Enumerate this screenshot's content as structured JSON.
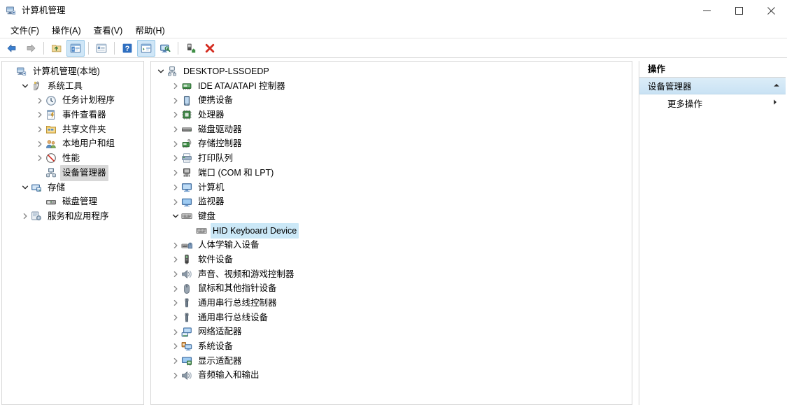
{
  "window": {
    "title": "计算机管理",
    "icon": "computer-management-icon",
    "controls": {
      "minimize": "最小化",
      "maximize": "最大化",
      "close": "关闭"
    }
  },
  "menubar": {
    "items": [
      {
        "label": "文件(F)",
        "name": "menu-file"
      },
      {
        "label": "操作(A)",
        "name": "menu-action"
      },
      {
        "label": "查看(V)",
        "name": "menu-view"
      },
      {
        "label": "帮助(H)",
        "name": "menu-help"
      }
    ]
  },
  "toolbar": {
    "buttons": [
      {
        "name": "back-button",
        "icon": "back-arrow-icon",
        "active": false
      },
      {
        "name": "forward-button",
        "icon": "forward-arrow-icon",
        "active": false
      },
      {
        "sep": true
      },
      {
        "name": "up-one-level-button",
        "icon": "folder-up-icon",
        "active": false
      },
      {
        "name": "show-hide-tree-button",
        "icon": "console-tree-icon",
        "active": true
      },
      {
        "sep": true
      },
      {
        "name": "properties-button",
        "icon": "properties-icon",
        "active": false
      },
      {
        "sep": true
      },
      {
        "name": "help-button",
        "icon": "help-question-icon",
        "active": false
      },
      {
        "name": "show-action-pane-button",
        "icon": "action-pane-icon",
        "active": true
      },
      {
        "name": "scan-hardware-button",
        "icon": "monitor-scan-icon",
        "active": false
      },
      {
        "sep": true
      },
      {
        "name": "update-driver-button",
        "icon": "update-driver-icon",
        "active": false
      },
      {
        "name": "uninstall-device-button",
        "icon": "red-x-icon",
        "active": false
      }
    ]
  },
  "console_tree": {
    "nodes": [
      {
        "label": "计算机管理(本地)",
        "indent": 0,
        "twisty": "none",
        "icon": "computer-management-icon",
        "selected": "none",
        "name": "tree-node-computer-management-local"
      },
      {
        "label": "系统工具",
        "indent": 1,
        "twisty": "expanded",
        "icon": "system-tools-icon",
        "selected": "none",
        "name": "tree-node-system-tools"
      },
      {
        "label": "任务计划程序",
        "indent": 2,
        "twisty": "collapsed",
        "icon": "task-scheduler-icon",
        "selected": "none",
        "name": "tree-node-task-scheduler"
      },
      {
        "label": "事件查看器",
        "indent": 2,
        "twisty": "collapsed",
        "icon": "event-viewer-icon",
        "selected": "none",
        "name": "tree-node-event-viewer"
      },
      {
        "label": "共享文件夹",
        "indent": 2,
        "twisty": "collapsed",
        "icon": "shared-folders-icon",
        "selected": "none",
        "name": "tree-node-shared-folders"
      },
      {
        "label": "本地用户和组",
        "indent": 2,
        "twisty": "collapsed",
        "icon": "local-users-groups-icon",
        "selected": "none",
        "name": "tree-node-local-users-and-groups"
      },
      {
        "label": "性能",
        "indent": 2,
        "twisty": "collapsed",
        "icon": "performance-icon",
        "selected": "none",
        "name": "tree-node-performance"
      },
      {
        "label": "设备管理器",
        "indent": 2,
        "twisty": "none",
        "icon": "device-manager-icon",
        "selected": "gray",
        "name": "tree-node-device-manager"
      },
      {
        "label": "存储",
        "indent": 1,
        "twisty": "expanded",
        "icon": "storage-icon",
        "selected": "none",
        "name": "tree-node-storage"
      },
      {
        "label": "磁盘管理",
        "indent": 2,
        "twisty": "none",
        "icon": "disk-management-icon",
        "selected": "none",
        "name": "tree-node-disk-management"
      },
      {
        "label": "服务和应用程序",
        "indent": 1,
        "twisty": "collapsed",
        "icon": "services-apps-icon",
        "selected": "none",
        "name": "tree-node-services-and-applications"
      }
    ]
  },
  "device_tree": {
    "nodes": [
      {
        "label": "DESKTOP-LSSOEDP",
        "indent": 0,
        "twisty": "expanded",
        "icon": "computer-root-icon",
        "selected": "none",
        "name": "device-node-root"
      },
      {
        "label": "IDE ATA/ATAPI 控制器",
        "indent": 1,
        "twisty": "collapsed",
        "icon": "ide-controller-icon",
        "selected": "none",
        "name": "device-node-ide-ata-atapi-controllers"
      },
      {
        "label": "便携设备",
        "indent": 1,
        "twisty": "collapsed",
        "icon": "portable-device-icon",
        "selected": "none",
        "name": "device-node-portable-devices"
      },
      {
        "label": "处理器",
        "indent": 1,
        "twisty": "collapsed",
        "icon": "processor-icon",
        "selected": "none",
        "name": "device-node-processors"
      },
      {
        "label": "磁盘驱动器",
        "indent": 1,
        "twisty": "collapsed",
        "icon": "disk-drive-icon",
        "selected": "none",
        "name": "device-node-disk-drives"
      },
      {
        "label": "存储控制器",
        "indent": 1,
        "twisty": "collapsed",
        "icon": "storage-controller-icon",
        "selected": "none",
        "name": "device-node-storage-controllers"
      },
      {
        "label": "打印队列",
        "indent": 1,
        "twisty": "collapsed",
        "icon": "print-queue-icon",
        "selected": "none",
        "name": "device-node-print-queues"
      },
      {
        "label": "端口 (COM 和 LPT)",
        "indent": 1,
        "twisty": "collapsed",
        "icon": "ports-icon",
        "selected": "none",
        "name": "device-node-ports-com-lpt"
      },
      {
        "label": "计算机",
        "indent": 1,
        "twisty": "collapsed",
        "icon": "computer-icon",
        "selected": "none",
        "name": "device-node-computer"
      },
      {
        "label": "监视器",
        "indent": 1,
        "twisty": "collapsed",
        "icon": "monitor-icon",
        "selected": "none",
        "name": "device-node-monitors"
      },
      {
        "label": "键盘",
        "indent": 1,
        "twisty": "expanded",
        "icon": "keyboard-icon",
        "selected": "none",
        "name": "device-node-keyboards"
      },
      {
        "label": "HID Keyboard Device",
        "indent": 2,
        "twisty": "none",
        "icon": "keyboard-icon",
        "selected": "blue",
        "name": "device-node-hid-keyboard-device"
      },
      {
        "label": "人体学输入设备",
        "indent": 1,
        "twisty": "collapsed",
        "icon": "hid-devices-icon",
        "selected": "none",
        "name": "device-node-human-interface-devices"
      },
      {
        "label": "软件设备",
        "indent": 1,
        "twisty": "collapsed",
        "icon": "software-device-icon",
        "selected": "none",
        "name": "device-node-software-devices"
      },
      {
        "label": "声音、视频和游戏控制器",
        "indent": 1,
        "twisty": "collapsed",
        "icon": "sound-video-game-icon",
        "selected": "none",
        "name": "device-node-sound-video-game-controllers"
      },
      {
        "label": "鼠标和其他指针设备",
        "indent": 1,
        "twisty": "collapsed",
        "icon": "mouse-icon",
        "selected": "none",
        "name": "device-node-mice-and-pointing-devices"
      },
      {
        "label": "通用串行总线控制器",
        "indent": 1,
        "twisty": "collapsed",
        "icon": "usb-controller-icon",
        "selected": "none",
        "name": "device-node-usb-controllers"
      },
      {
        "label": "通用串行总线设备",
        "indent": 1,
        "twisty": "collapsed",
        "icon": "usb-device-icon",
        "selected": "none",
        "name": "device-node-usb-devices"
      },
      {
        "label": "网络适配器",
        "indent": 1,
        "twisty": "collapsed",
        "icon": "network-adapter-icon",
        "selected": "none",
        "name": "device-node-network-adapters"
      },
      {
        "label": "系统设备",
        "indent": 1,
        "twisty": "collapsed",
        "icon": "system-device-icon",
        "selected": "none",
        "name": "device-node-system-devices"
      },
      {
        "label": "显示适配器",
        "indent": 1,
        "twisty": "collapsed",
        "icon": "display-adapter-icon",
        "selected": "none",
        "name": "device-node-display-adapters"
      },
      {
        "label": "音频输入和输出",
        "indent": 1,
        "twisty": "collapsed",
        "icon": "audio-io-icon",
        "selected": "none",
        "name": "device-node-audio-inputs-and-outputs"
      }
    ]
  },
  "actions_pane": {
    "title": "操作",
    "section_label": "设备管理器",
    "section_collapse_icon": "chevron-up-icon",
    "rows": [
      {
        "label": "更多操作",
        "icon": "submenu-arrow-icon",
        "name": "action-more-actions"
      }
    ]
  },
  "colors": {
    "selection_blue": "#cbe8f7",
    "selection_gray": "#d8d8d8",
    "actions_header": "#c9e2f4",
    "accent_red": "#d42b1f",
    "border": "#d6d6d6"
  }
}
